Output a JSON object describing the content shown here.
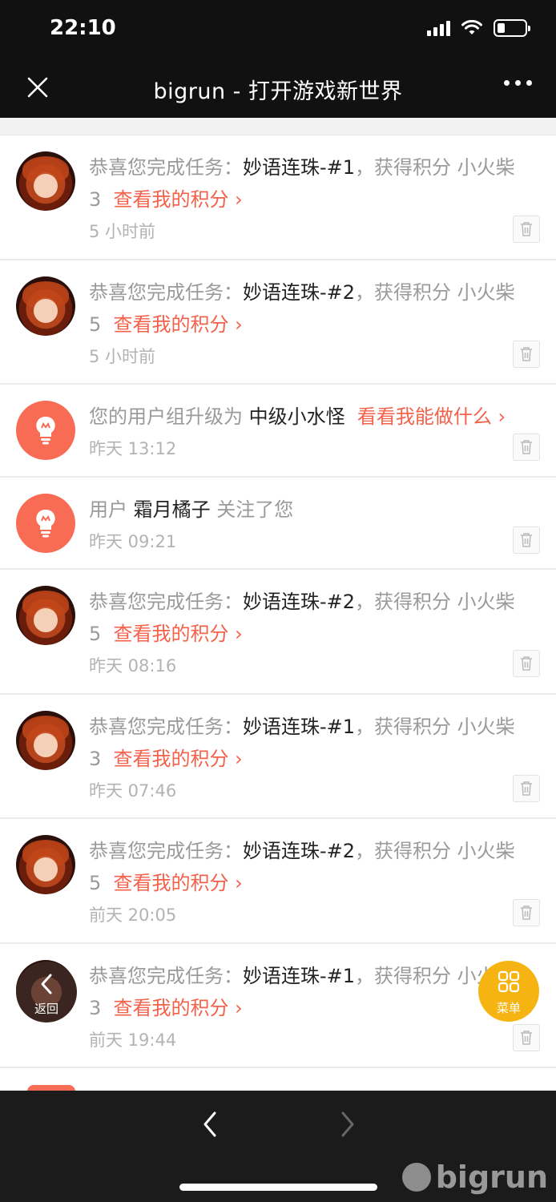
{
  "status": {
    "time": "22:10"
  },
  "nav": {
    "title": "bigrun - 打开游戏新世界",
    "close_icon": "close-icon",
    "more_icon": "more-icon"
  },
  "items": [
    {
      "avatar": "user-avatar",
      "prefix": "恭喜您完成任务：",
      "task": "妙语连珠-#1",
      "mid": "，获得积分 小火柴",
      "points": "3",
      "link": "查看我的积分 ›",
      "time": "5 小时前"
    },
    {
      "avatar": "user-avatar",
      "prefix": "恭喜您完成任务：",
      "task": "妙语连珠-#2",
      "mid": "，获得积分 小火柴",
      "points": "5",
      "link": "查看我的积分 ›",
      "time": "5 小时前"
    },
    {
      "avatar": "bulb-icon",
      "prefix": "您的用户组升级为 ",
      "group": "中级小水怪",
      "link": "看看我能做什么 ›",
      "time": "昨天 13:12"
    },
    {
      "avatar": "bulb-icon",
      "prefix": "用户 ",
      "user": "霜月橘子",
      "suffix": " 关注了您",
      "time": "昨天 09:21"
    },
    {
      "avatar": "user-avatar",
      "prefix": "恭喜您完成任务：",
      "task": "妙语连珠-#2",
      "mid": "，获得积分 小火柴",
      "points": "5",
      "link": "查看我的积分 ›",
      "time": "昨天 08:16"
    },
    {
      "avatar": "user-avatar",
      "prefix": "恭喜您完成任务：",
      "task": "妙语连珠-#1",
      "mid": "，获得积分 小火柴",
      "points": "3",
      "link": "查看我的积分 ›",
      "time": "昨天 07:46"
    },
    {
      "avatar": "user-avatar",
      "prefix": "恭喜您完成任务：",
      "task": "妙语连珠-#2",
      "mid": "，获得积分 小火柴",
      "points": "5",
      "link": "查看我的积分 ›",
      "time": "前天 20:05"
    },
    {
      "avatar": "user-avatar",
      "prefix": "恭喜您完成任务：",
      "task": "妙语连珠-#1",
      "mid": "，获得积分 小火柴",
      "points": "3",
      "link": "查看我的积分 ›",
      "time": "前天 19:44"
    }
  ],
  "fab": {
    "back_label": "返回",
    "menu_label": "菜单"
  },
  "watermark": "bigrun",
  "colors": {
    "link": "#f4614a",
    "menu_fab": "#f6b412",
    "bulb_bg": "#f86b55"
  }
}
